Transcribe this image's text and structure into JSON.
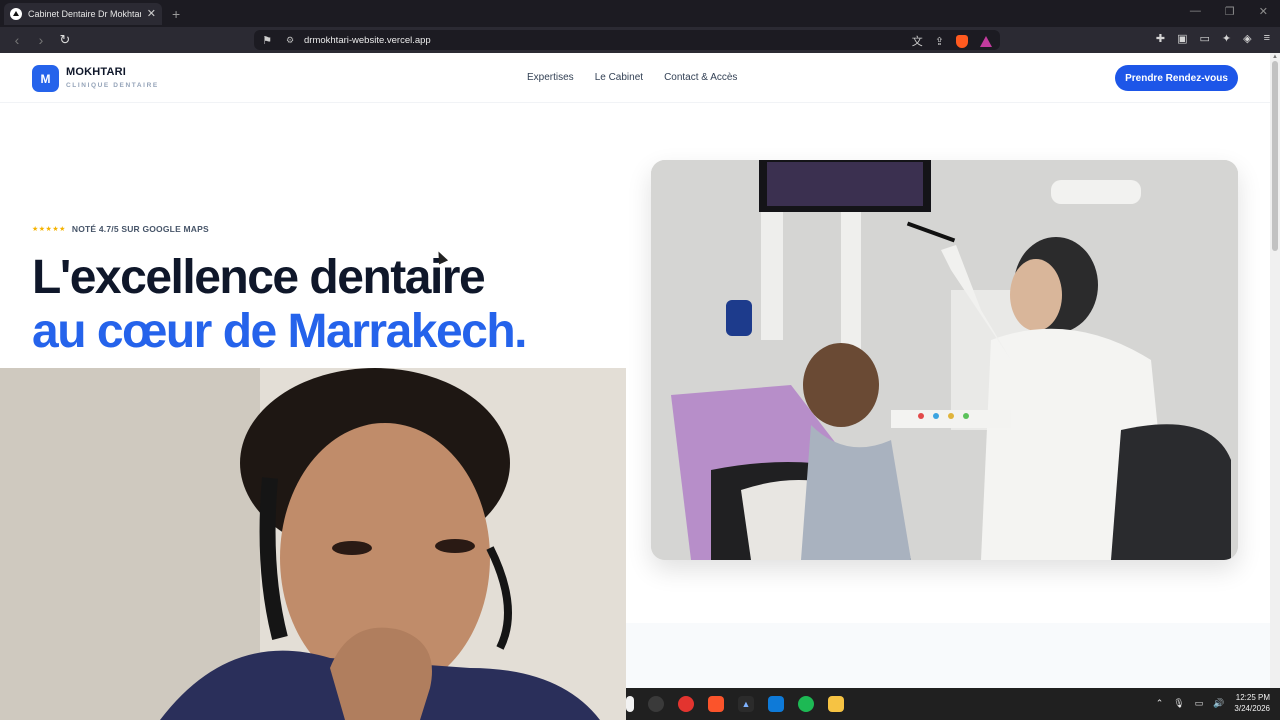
{
  "browser": {
    "tab_title": "Cabinet Dentaire Dr Mokhtari N",
    "tab_close": "✕",
    "new_tab": "+",
    "url": "drmokhtari-website.vercel.app"
  },
  "site": {
    "logo_letter": "M",
    "brand_name": "MOKHTARI",
    "brand_sub": "CLINIQUE DENTAIRE",
    "nav": [
      "Expertises",
      "Le Cabinet",
      "Contact & Accès"
    ],
    "cta_label": "Prendre Rendez-vous",
    "rating_stars": "★★★★★",
    "rating_text": "NOTÉ 4.7/5 SUR GOOGLE MAPS",
    "headline_line1": "L'excellence dentaire",
    "headline_line2": "au cœur de Marrakech."
  },
  "taskbar": {
    "time": "12:25 PM",
    "date": "3/24/2026"
  },
  "colors": {
    "accent": "#2563eb",
    "heading": "#0f172a"
  }
}
